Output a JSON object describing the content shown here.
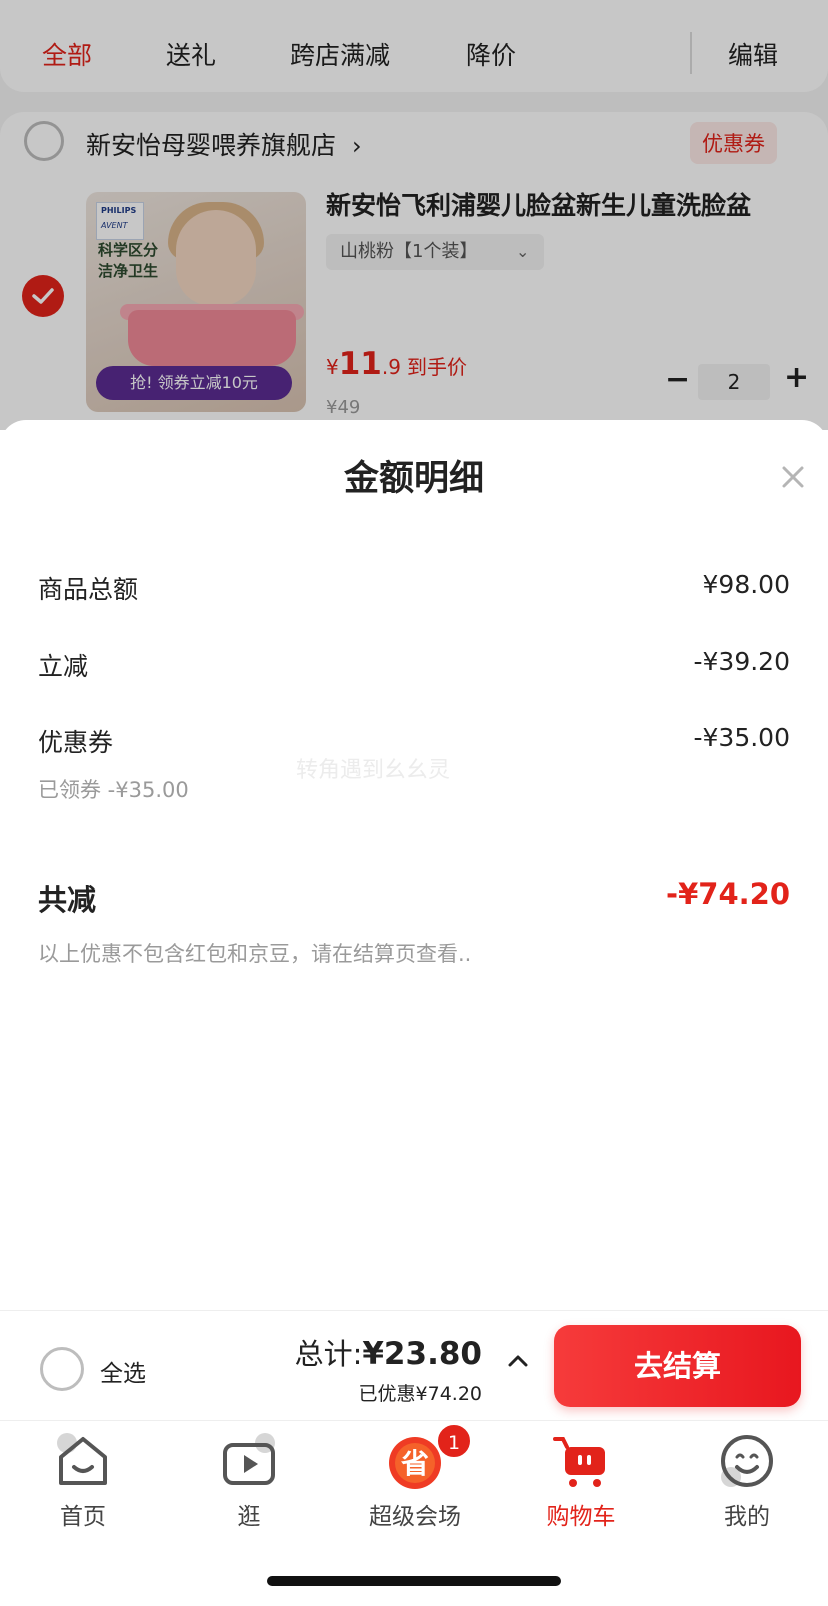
{
  "tabs": [
    {
      "label": "全部",
      "active": true
    },
    {
      "label": "送礼",
      "active": false
    },
    {
      "label": "跨店满减",
      "active": false
    },
    {
      "label": "降价",
      "active": false
    }
  ],
  "edit_label": "编辑",
  "shop": {
    "name": "新安怡母婴喂养旗舰店",
    "arrow": "›",
    "coupon_label": "优惠券"
  },
  "product": {
    "title": "新安怡飞利浦婴儿脸盆新生儿童洗脸盆",
    "sku": "山桃粉【1个装】",
    "sku_arrow": "⌄",
    "image": {
      "brand_top": "PHILIPS",
      "brand_bottom": "AVENT",
      "tagline_1": "科学区分",
      "tagline_2": "洁净卫生",
      "promo": "抢! 领券立减10元"
    },
    "price_symbol": "¥",
    "price_int": "11",
    "price_dec": ".9",
    "price_hint": "到手价",
    "original_price": "¥49",
    "quantity": "2",
    "minus": "−",
    "plus": "+"
  },
  "sheet": {
    "title": "金额明细",
    "close_icon": "close-icon",
    "rows": [
      {
        "label": "商品总额",
        "value": "¥98.00"
      },
      {
        "label": "立减",
        "value": "-¥39.20"
      },
      {
        "label": "优惠券",
        "value": "-¥35.00",
        "note": "已领券 -¥35.00"
      }
    ],
    "watermark": "转角遇到幺幺灵",
    "total_label": "共减",
    "total_value": "-¥74.20",
    "disclaimer": "以上优惠不包含红包和京豆，请在结算页查看.."
  },
  "checkout": {
    "select_all": "全选",
    "total_label": "总计:",
    "total_value": "¥23.80",
    "saved": "已优惠¥74.20",
    "pay_button": "去结算"
  },
  "nav": [
    {
      "label": "首页",
      "icon": "home-icon"
    },
    {
      "label": "逛",
      "icon": "video-play-icon"
    },
    {
      "label": "超级会场",
      "icon": "super-venue-icon",
      "badge": "1",
      "icon_char": "省"
    },
    {
      "label": "购物车",
      "icon": "cart-icon",
      "active": true
    },
    {
      "label": "我的",
      "icon": "profile-icon"
    }
  ],
  "colors": {
    "accent": "#e2231a",
    "muted": "#9a9a9a"
  }
}
